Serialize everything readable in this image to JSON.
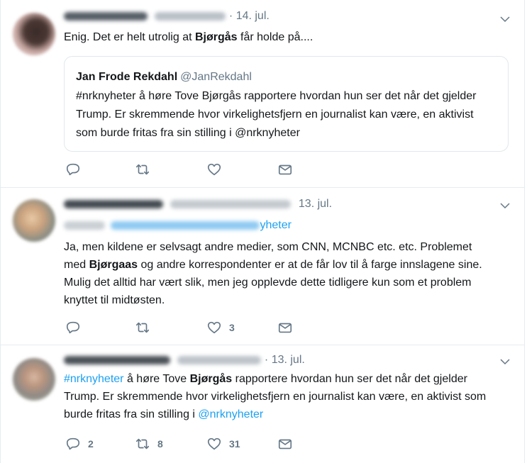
{
  "tweets": [
    {
      "date": "14. jul.",
      "text_before": "Enig. Det er helt utrolig at ",
      "text_bold": "Bjørgås",
      "text_after": " får holde på....",
      "quote": {
        "name": "Jan Frode Rekdahl",
        "handle": "@JanRekdahl",
        "text": "#nrknyheter å høre Tove Bjørgås rapportere hvordan hun ser det når det gjelder Trump. Er skremmende hvor virkelighetsfjern en journalist kan være, en aktivist som burde fritas fra sin stilling i @nrknyheter"
      },
      "actions": {
        "reply": "",
        "retweet": "",
        "like": ""
      }
    },
    {
      "date": "13. jul.",
      "mention_visible": "yheter",
      "text_before": "Ja, men kildene er selvsagt andre medier, som CNN, MCNBC etc. etc. Problemet med ",
      "text_bold": "Bjørgaas",
      "text_after": " og andre korrespondenter er at de får lov til å farge innslagene sine. Mulig det alltid har vært slik, men jeg opplevde dette tidligere kun som et problem knyttet til midtøsten.",
      "actions": {
        "reply": "",
        "retweet": "",
        "like": "3"
      }
    },
    {
      "date": "13. jul.",
      "hashtag": "#nrknyheter",
      "text_mid1": " å høre Tove ",
      "text_bold": "Bjørgås",
      "text_mid2": " rapportere hvordan hun ser det når det gjelder Trump. Er skremmende hvor virkelighetsfjern en journalist kan være, en aktivist som burde fritas fra sin stilling i ",
      "mention": "@nrknyheter",
      "actions": {
        "reply": "2",
        "retweet": "8",
        "like": "31"
      }
    }
  ],
  "colors": {
    "text": "#14171a",
    "muted": "#657786",
    "link": "#1da1f2",
    "border": "#e6ecf0"
  },
  "icons": [
    "reply-icon",
    "retweet-icon",
    "like-icon",
    "dm-icon",
    "chevron-down-icon"
  ]
}
